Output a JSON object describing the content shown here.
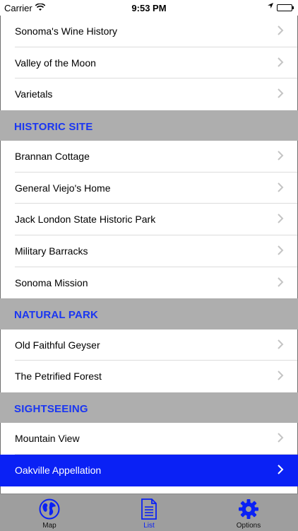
{
  "status_bar": {
    "carrier": "Carrier",
    "time": "9:53 PM"
  },
  "list": {
    "top_items": [
      {
        "label": "Sonoma's Wine History"
      },
      {
        "label": "Valley of the Moon"
      },
      {
        "label": "Varietals"
      }
    ],
    "sections": [
      {
        "title": "HISTORIC SITE",
        "items": [
          {
            "label": "Brannan Cottage"
          },
          {
            "label": "General Viejo's Home"
          },
          {
            "label": "Jack London State Historic Park"
          },
          {
            "label": "Military Barracks"
          },
          {
            "label": "Sonoma Mission"
          }
        ]
      },
      {
        "title": "NATURAL PARK",
        "items": [
          {
            "label": "Old Faithful Geyser"
          },
          {
            "label": "The Petrified Forest"
          }
        ]
      },
      {
        "title": "SIGHTSEEING",
        "items": [
          {
            "label": "Mountain View"
          },
          {
            "label": "Oakville Appellation",
            "selected": true
          }
        ]
      }
    ]
  },
  "tab_bar": {
    "tabs": [
      {
        "label": "Map",
        "icon": "globe-icon"
      },
      {
        "label": "List",
        "icon": "document-icon",
        "active": true
      },
      {
        "label": "Options",
        "icon": "gear-icon"
      }
    ]
  },
  "colors": {
    "accent": "#1a36f2",
    "selected_row": "#0a21f5",
    "section_bg": "#aeaeae",
    "tab_bar_bg": "#9e9e9e"
  }
}
